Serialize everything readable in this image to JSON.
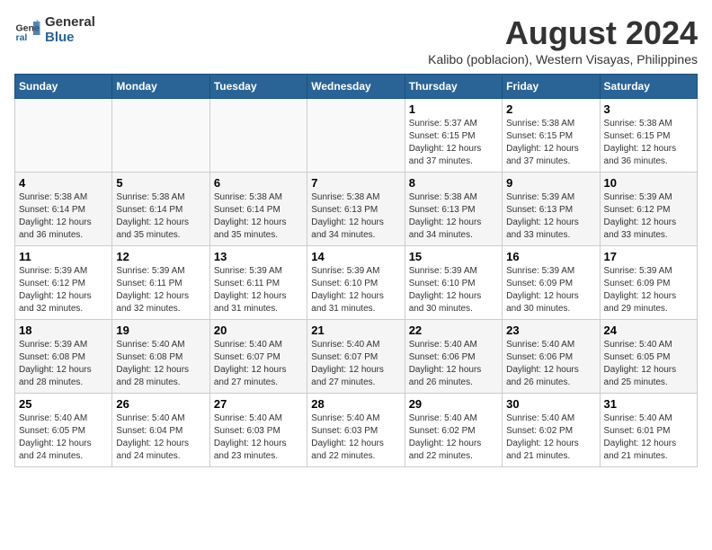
{
  "logo": {
    "line1": "General",
    "line2": "Blue"
  },
  "title": "August 2024",
  "subtitle": "Kalibo (poblacion), Western Visayas, Philippines",
  "days_of_week": [
    "Sunday",
    "Monday",
    "Tuesday",
    "Wednesday",
    "Thursday",
    "Friday",
    "Saturday"
  ],
  "weeks": [
    [
      {
        "num": "",
        "detail": ""
      },
      {
        "num": "",
        "detail": ""
      },
      {
        "num": "",
        "detail": ""
      },
      {
        "num": "",
        "detail": ""
      },
      {
        "num": "1",
        "detail": "Sunrise: 5:37 AM\nSunset: 6:15 PM\nDaylight: 12 hours\nand 37 minutes."
      },
      {
        "num": "2",
        "detail": "Sunrise: 5:38 AM\nSunset: 6:15 PM\nDaylight: 12 hours\nand 37 minutes."
      },
      {
        "num": "3",
        "detail": "Sunrise: 5:38 AM\nSunset: 6:15 PM\nDaylight: 12 hours\nand 36 minutes."
      }
    ],
    [
      {
        "num": "4",
        "detail": "Sunrise: 5:38 AM\nSunset: 6:14 PM\nDaylight: 12 hours\nand 36 minutes."
      },
      {
        "num": "5",
        "detail": "Sunrise: 5:38 AM\nSunset: 6:14 PM\nDaylight: 12 hours\nand 35 minutes."
      },
      {
        "num": "6",
        "detail": "Sunrise: 5:38 AM\nSunset: 6:14 PM\nDaylight: 12 hours\nand 35 minutes."
      },
      {
        "num": "7",
        "detail": "Sunrise: 5:38 AM\nSunset: 6:13 PM\nDaylight: 12 hours\nand 34 minutes."
      },
      {
        "num": "8",
        "detail": "Sunrise: 5:38 AM\nSunset: 6:13 PM\nDaylight: 12 hours\nand 34 minutes."
      },
      {
        "num": "9",
        "detail": "Sunrise: 5:39 AM\nSunset: 6:13 PM\nDaylight: 12 hours\nand 33 minutes."
      },
      {
        "num": "10",
        "detail": "Sunrise: 5:39 AM\nSunset: 6:12 PM\nDaylight: 12 hours\nand 33 minutes."
      }
    ],
    [
      {
        "num": "11",
        "detail": "Sunrise: 5:39 AM\nSunset: 6:12 PM\nDaylight: 12 hours\nand 32 minutes."
      },
      {
        "num": "12",
        "detail": "Sunrise: 5:39 AM\nSunset: 6:11 PM\nDaylight: 12 hours\nand 32 minutes."
      },
      {
        "num": "13",
        "detail": "Sunrise: 5:39 AM\nSunset: 6:11 PM\nDaylight: 12 hours\nand 31 minutes."
      },
      {
        "num": "14",
        "detail": "Sunrise: 5:39 AM\nSunset: 6:10 PM\nDaylight: 12 hours\nand 31 minutes."
      },
      {
        "num": "15",
        "detail": "Sunrise: 5:39 AM\nSunset: 6:10 PM\nDaylight: 12 hours\nand 30 minutes."
      },
      {
        "num": "16",
        "detail": "Sunrise: 5:39 AM\nSunset: 6:09 PM\nDaylight: 12 hours\nand 30 minutes."
      },
      {
        "num": "17",
        "detail": "Sunrise: 5:39 AM\nSunset: 6:09 PM\nDaylight: 12 hours\nand 29 minutes."
      }
    ],
    [
      {
        "num": "18",
        "detail": "Sunrise: 5:39 AM\nSunset: 6:08 PM\nDaylight: 12 hours\nand 28 minutes."
      },
      {
        "num": "19",
        "detail": "Sunrise: 5:40 AM\nSunset: 6:08 PM\nDaylight: 12 hours\nand 28 minutes."
      },
      {
        "num": "20",
        "detail": "Sunrise: 5:40 AM\nSunset: 6:07 PM\nDaylight: 12 hours\nand 27 minutes."
      },
      {
        "num": "21",
        "detail": "Sunrise: 5:40 AM\nSunset: 6:07 PM\nDaylight: 12 hours\nand 27 minutes."
      },
      {
        "num": "22",
        "detail": "Sunrise: 5:40 AM\nSunset: 6:06 PM\nDaylight: 12 hours\nand 26 minutes."
      },
      {
        "num": "23",
        "detail": "Sunrise: 5:40 AM\nSunset: 6:06 PM\nDaylight: 12 hours\nand 26 minutes."
      },
      {
        "num": "24",
        "detail": "Sunrise: 5:40 AM\nSunset: 6:05 PM\nDaylight: 12 hours\nand 25 minutes."
      }
    ],
    [
      {
        "num": "25",
        "detail": "Sunrise: 5:40 AM\nSunset: 6:05 PM\nDaylight: 12 hours\nand 24 minutes."
      },
      {
        "num": "26",
        "detail": "Sunrise: 5:40 AM\nSunset: 6:04 PM\nDaylight: 12 hours\nand 24 minutes."
      },
      {
        "num": "27",
        "detail": "Sunrise: 5:40 AM\nSunset: 6:03 PM\nDaylight: 12 hours\nand 23 minutes."
      },
      {
        "num": "28",
        "detail": "Sunrise: 5:40 AM\nSunset: 6:03 PM\nDaylight: 12 hours\nand 22 minutes."
      },
      {
        "num": "29",
        "detail": "Sunrise: 5:40 AM\nSunset: 6:02 PM\nDaylight: 12 hours\nand 22 minutes."
      },
      {
        "num": "30",
        "detail": "Sunrise: 5:40 AM\nSunset: 6:02 PM\nDaylight: 12 hours\nand 21 minutes."
      },
      {
        "num": "31",
        "detail": "Sunrise: 5:40 AM\nSunset: 6:01 PM\nDaylight: 12 hours\nand 21 minutes."
      }
    ]
  ]
}
